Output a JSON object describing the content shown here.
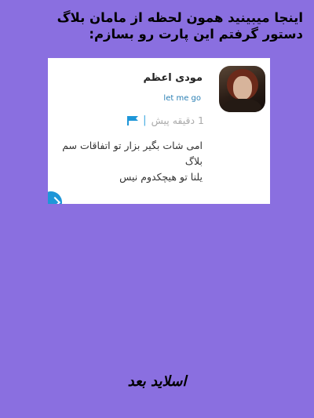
{
  "header": {
    "line1": "اینجا میبینید همون لحظه از مامان بلاگ",
    "line2": "دستور گرفتم این پارت رو بسازم:"
  },
  "card": {
    "username": "مودی اعظم",
    "subtitle": "let me go",
    "meta_time": "1 دقیقه پیش",
    "meta_separator": "|",
    "message_line1": "امی شات بگیر بزار تو اتفاقات سم",
    "message_line2": "بلاگ",
    "message_line3": "یلنا تو هیچکدوم نیس"
  },
  "footer": {
    "text": "اسلاید بعد"
  },
  "colors": {
    "background": "#8a6fe0",
    "card": "#ffffff",
    "accent": "#1e96d8"
  },
  "icons": {
    "flag": "flag-icon",
    "fab": "scroll-up-icon"
  }
}
